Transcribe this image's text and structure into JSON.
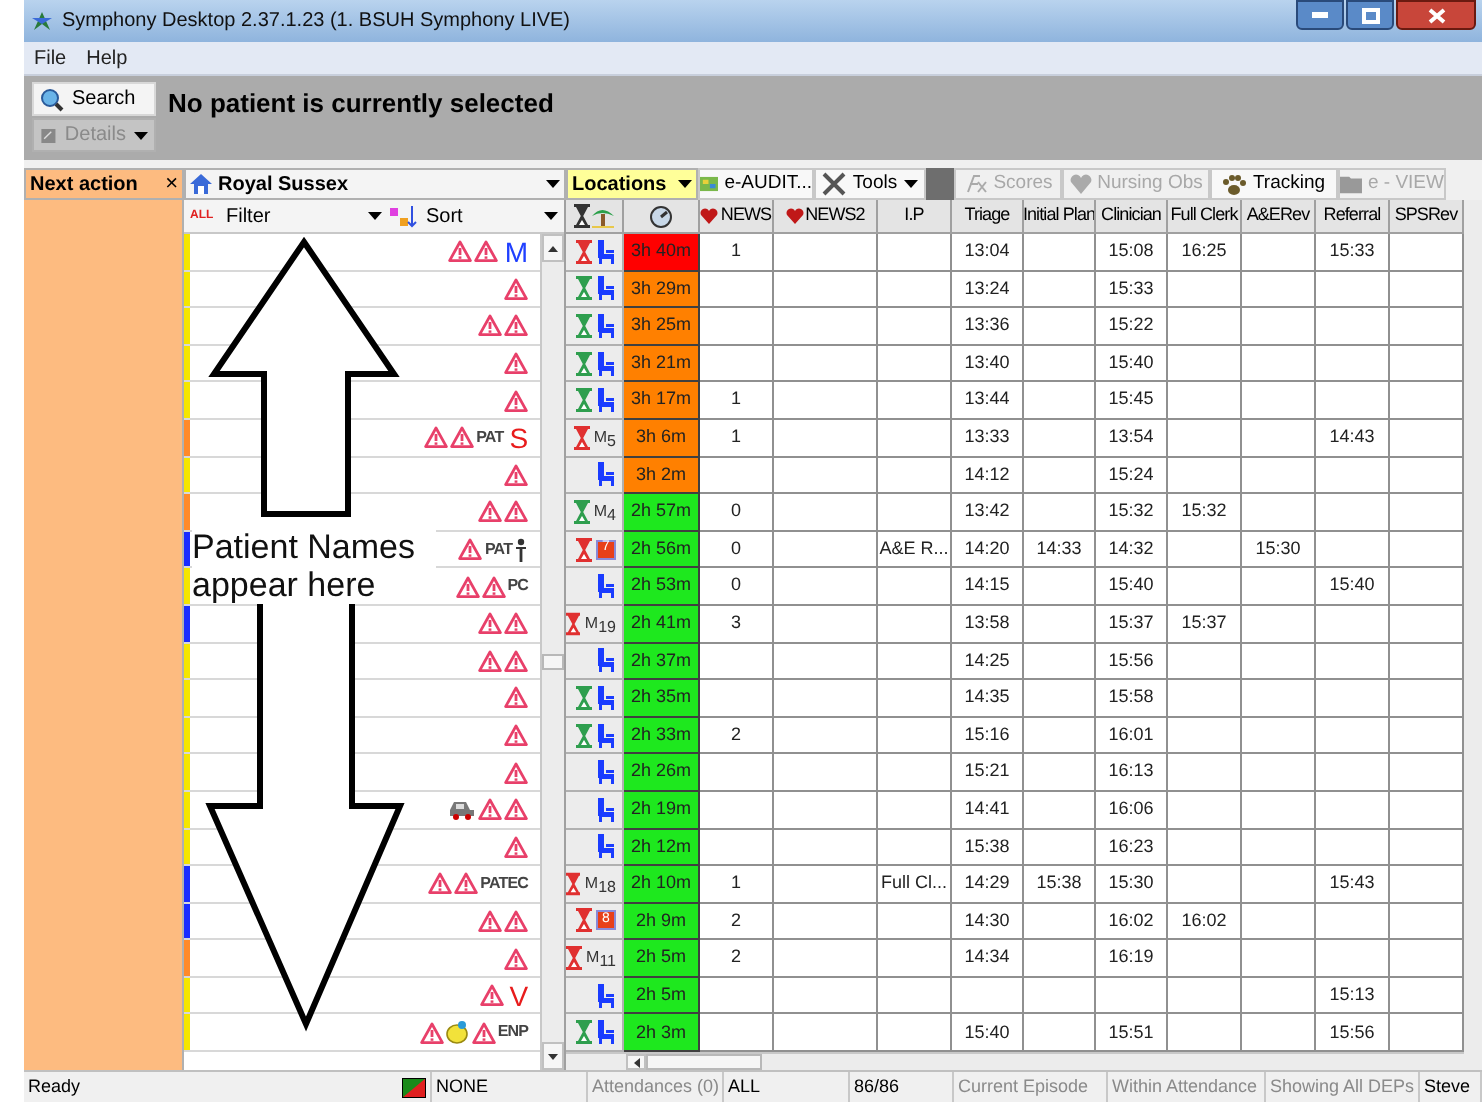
{
  "window": {
    "title": "Symphony Desktop 2.37.1.23 (1. BSUH Symphony LIVE)"
  },
  "menu": [
    {
      "label": "File"
    },
    {
      "label": "Help"
    }
  ],
  "patient_bar": {
    "buttons": [
      {
        "label": "Search",
        "disabled": false
      },
      {
        "label": "Details",
        "disabled": true
      }
    ],
    "message": "No patient is currently selected"
  },
  "next_action": {
    "label": "Next action",
    "close": "×"
  },
  "site": {
    "value": "Royal Sussex"
  },
  "locations": {
    "value": "Locations"
  },
  "toolbar": [
    {
      "label": "e-AUDIT...",
      "disabled": false,
      "kind": "button"
    },
    {
      "label": "Tools",
      "disabled": false,
      "kind": "menu"
    },
    {
      "label": "Scores",
      "disabled": true,
      "kind": "button"
    },
    {
      "label": "Nursing Obs",
      "disabled": true,
      "kind": "button"
    },
    {
      "label": "Tracking",
      "disabled": false,
      "kind": "button"
    },
    {
      "label": "e - VIEW",
      "disabled": true,
      "kind": "button"
    }
  ],
  "list_header": {
    "all": "ALL",
    "filter": "Filter",
    "sort": "Sort"
  },
  "columns": [
    "NEWS",
    "NEWS2",
    "I.P",
    "Triage",
    "Initial Plan",
    "Clinician",
    "Full Clerk",
    "A&ERev",
    "Referral",
    "SPSRev"
  ],
  "annotation": {
    "text": "Patient Names appear here"
  },
  "rows": [
    {
      "color": "#f5e600",
      "flags": [
        {
          "kind": "alert"
        },
        {
          "kind": "alert"
        },
        {
          "kind": "letter",
          "text": "M",
          "color": "#2040ff"
        }
      ],
      "timer": {
        "color": "#e03030"
      },
      "status": {
        "kind": "chair"
      },
      "wait": {
        "text": "3h 40m",
        "color": "#ff0000"
      },
      "cells": [
        "1",
        null,
        null,
        "13:04",
        null,
        "15:08",
        "16:25",
        null,
        "15:33",
        null
      ]
    },
    {
      "color": "#f5e600",
      "flags": [
        {
          "kind": "alert"
        }
      ],
      "timer": {
        "color": "#2e9e4e"
      },
      "status": {
        "kind": "chair"
      },
      "wait": {
        "text": "3h 29m",
        "color": "#ff8000"
      },
      "cells": [
        null,
        null,
        null,
        "13:24",
        null,
        "15:33",
        null,
        null,
        null,
        null
      ]
    },
    {
      "color": "#f5e600",
      "flags": [
        {
          "kind": "alert"
        },
        {
          "kind": "alert"
        }
      ],
      "timer": {
        "color": "#2e9e4e"
      },
      "status": {
        "kind": "chair"
      },
      "wait": {
        "text": "3h 25m",
        "color": "#ff8000"
      },
      "cells": [
        null,
        null,
        null,
        "13:36",
        null,
        "15:22",
        null,
        null,
        null,
        null
      ]
    },
    {
      "color": "#f5e600",
      "flags": [
        {
          "kind": "alert"
        }
      ],
      "timer": {
        "color": "#2e9e4e"
      },
      "status": {
        "kind": "chair"
      },
      "wait": {
        "text": "3h 21m",
        "color": "#ff8000"
      },
      "cells": [
        null,
        null,
        null,
        "13:40",
        null,
        "15:40",
        null,
        null,
        null,
        null
      ]
    },
    {
      "color": "#f5e600",
      "flags": [
        {
          "kind": "alert"
        }
      ],
      "timer": {
        "color": "#2e9e4e"
      },
      "status": {
        "kind": "chair"
      },
      "wait": {
        "text": "3h 17m",
        "color": "#ff8000"
      },
      "cells": [
        "1",
        null,
        null,
        "13:44",
        null,
        "15:45",
        null,
        null,
        null,
        null
      ]
    },
    {
      "color": "#ff8a2a",
      "flags": [
        {
          "kind": "alert"
        },
        {
          "kind": "alert"
        },
        {
          "kind": "code",
          "text": "PAT"
        },
        {
          "kind": "letter",
          "text": "S",
          "color": "#e81c1c"
        }
      ],
      "timer": {
        "color": "#e03030"
      },
      "status": {
        "kind": "m",
        "text": "M",
        "sub": "5"
      },
      "wait": {
        "text": "3h 6m",
        "color": "#ff8000"
      },
      "cells": [
        "1",
        null,
        null,
        "13:33",
        null,
        "13:54",
        null,
        null,
        "14:43",
        null
      ]
    },
    {
      "color": "#f5e600",
      "flags": [
        {
          "kind": "alert"
        }
      ],
      "status": {
        "kind": "chair"
      },
      "wait": {
        "text": "3h 2m",
        "color": "#ff8000"
      },
      "cells": [
        null,
        null,
        null,
        "14:12",
        null,
        "15:24",
        null,
        null,
        null,
        null
      ]
    },
    {
      "color": "#ff8a2a",
      "flags": [
        {
          "kind": "alert"
        },
        {
          "kind": "alert"
        }
      ],
      "timer": {
        "color": "#2e9e4e"
      },
      "status": {
        "kind": "m",
        "text": "M",
        "sub": "4"
      },
      "wait": {
        "text": "2h 57m",
        "color": "#1ee81e"
      },
      "cells": [
        "0",
        null,
        null,
        "13:42",
        null,
        "15:32",
        "15:32",
        null,
        null,
        null
      ]
    },
    {
      "color": "#1a2cff",
      "flags": [
        {
          "kind": "alert"
        },
        {
          "kind": "code",
          "text": "PAT"
        },
        {
          "kind": "person"
        }
      ],
      "timer": {
        "color": "#e03030"
      },
      "status": {
        "kind": "badge",
        "text": "7"
      },
      "wait": {
        "text": "2h 56m",
        "color": "#1ee81e"
      },
      "cells": [
        "0",
        null,
        "A&E R...",
        "14:20",
        "14:33",
        "14:32",
        null,
        "15:30",
        null,
        null
      ]
    },
    {
      "color": "#f5e600",
      "flags": [
        {
          "kind": "alert"
        },
        {
          "kind": "alert"
        },
        {
          "kind": "code",
          "text": "PC"
        }
      ],
      "status": {
        "kind": "chair"
      },
      "wait": {
        "text": "2h 53m",
        "color": "#1ee81e"
      },
      "cells": [
        "0",
        null,
        null,
        "14:15",
        null,
        "15:40",
        null,
        null,
        "15:40",
        null
      ]
    },
    {
      "color": "#1a2cff",
      "flags": [
        {
          "kind": "alert"
        },
        {
          "kind": "alert"
        }
      ],
      "timer": {
        "color": "#e03030"
      },
      "status": {
        "kind": "m",
        "text": "M",
        "sub": "19"
      },
      "wait": {
        "text": "2h 41m",
        "color": "#1ee81e"
      },
      "cells": [
        "3",
        null,
        null,
        "13:58",
        null,
        "15:37",
        "15:37",
        null,
        null,
        null
      ]
    },
    {
      "color": "#f5e600",
      "flags": [
        {
          "kind": "alert"
        },
        {
          "kind": "alert"
        }
      ],
      "status": {
        "kind": "chair"
      },
      "wait": {
        "text": "2h 37m",
        "color": "#1ee81e"
      },
      "cells": [
        null,
        null,
        null,
        "14:25",
        null,
        "15:56",
        null,
        null,
        null,
        null
      ]
    },
    {
      "color": "#f5e600",
      "flags": [
        {
          "kind": "alert"
        }
      ],
      "timer": {
        "color": "#2e9e4e"
      },
      "status": {
        "kind": "chair"
      },
      "wait": {
        "text": "2h 35m",
        "color": "#1ee81e"
      },
      "cells": [
        null,
        null,
        null,
        "14:35",
        null,
        "15:58",
        null,
        null,
        null,
        null
      ]
    },
    {
      "color": "#f5e600",
      "flags": [
        {
          "kind": "alert"
        }
      ],
      "timer": {
        "color": "#2e9e4e"
      },
      "status": {
        "kind": "chair"
      },
      "wait": {
        "text": "2h 33m",
        "color": "#1ee81e"
      },
      "cells": [
        "2",
        null,
        null,
        "15:16",
        null,
        "16:01",
        null,
        null,
        null,
        null
      ]
    },
    {
      "color": "#f5e600",
      "flags": [
        {
          "kind": "alert"
        }
      ],
      "status": {
        "kind": "chair"
      },
      "wait": {
        "text": "2h 26m",
        "color": "#1ee81e"
      },
      "cells": [
        null,
        null,
        null,
        "15:21",
        null,
        "16:13",
        null,
        null,
        null,
        null
      ]
    },
    {
      "color": "#f5e600",
      "flags": [
        {
          "kind": "vehicle"
        },
        {
          "kind": "alert"
        },
        {
          "kind": "alert"
        }
      ],
      "status": {
        "kind": "chair"
      },
      "wait": {
        "text": "2h 19m",
        "color": "#1ee81e"
      },
      "cells": [
        null,
        null,
        null,
        "14:41",
        null,
        "16:06",
        null,
        null,
        null,
        null
      ]
    },
    {
      "color": "#f5e600",
      "flags": [
        {
          "kind": "alert"
        }
      ],
      "status": {
        "kind": "chair"
      },
      "wait": {
        "text": "2h 12m",
        "color": "#1ee81e"
      },
      "cells": [
        null,
        null,
        null,
        "15:38",
        null,
        "16:23",
        null,
        null,
        null,
        null
      ]
    },
    {
      "color": "#1a2cff",
      "flags": [
        {
          "kind": "alert"
        },
        {
          "kind": "alert"
        },
        {
          "kind": "code",
          "text": "PATEC"
        }
      ],
      "timer": {
        "color": "#e03030"
      },
      "status": {
        "kind": "m",
        "text": "M",
        "sub": "18"
      },
      "wait": {
        "text": "2h 10m",
        "color": "#1ee81e"
      },
      "cells": [
        "1",
        null,
        "Full Cl...",
        "14:29",
        "15:38",
        "15:30",
        null,
        null,
        "15:43",
        null
      ]
    },
    {
      "color": "#1a2cff",
      "flags": [
        {
          "kind": "alert"
        },
        {
          "kind": "alert"
        }
      ],
      "timer": {
        "color": "#e03030"
      },
      "status": {
        "kind": "badge",
        "text": "8"
      },
      "wait": {
        "text": "2h 9m",
        "color": "#1ee81e"
      },
      "cells": [
        "2",
        null,
        null,
        "14:30",
        null,
        "16:02",
        "16:02",
        null,
        null,
        null
      ]
    },
    {
      "color": "#ff8a2a",
      "flags": [
        {
          "kind": "alert"
        }
      ],
      "timer": {
        "color": "#e03030"
      },
      "status": {
        "kind": "m",
        "text": "M",
        "sub": "11"
      },
      "wait": {
        "text": "2h 5m",
        "color": "#1ee81e"
      },
      "cells": [
        "2",
        null,
        null,
        "14:34",
        null,
        "16:19",
        null,
        null,
        null,
        null
      ]
    },
    {
      "color": "#f5e600",
      "flags": [
        {
          "kind": "alert"
        },
        {
          "kind": "letter",
          "text": "V",
          "color": "#e81c1c"
        }
      ],
      "status": {
        "kind": "chair"
      },
      "wait": {
        "text": "2h 5m",
        "color": "#1ee81e"
      },
      "cells": [
        null,
        null,
        null,
        null,
        null,
        null,
        null,
        null,
        "15:13",
        null
      ]
    },
    {
      "color": "#f5e600",
      "flags": [
        {
          "kind": "alert"
        },
        {
          "kind": "fruit"
        },
        {
          "kind": "alert"
        },
        {
          "kind": "code",
          "text": "ENP"
        }
      ],
      "timer": {
        "color": "#2e9e4e"
      },
      "status": {
        "kind": "chair"
      },
      "wait": {
        "text": "2h 3m",
        "color": "#1ee81e"
      },
      "cells": [
        null,
        null,
        null,
        "15:40",
        null,
        "15:51",
        null,
        null,
        "15:56",
        null
      ]
    }
  ],
  "status_bar": [
    {
      "text": "Ready",
      "disabled": false
    },
    {
      "text": "NONE",
      "disabled": false
    },
    {
      "text": "Attendances (0)",
      "disabled": true
    },
    {
      "text": "ALL",
      "disabled": false
    },
    {
      "text": "86/86",
      "disabled": false
    },
    {
      "text": "Current Episode",
      "disabled": true
    },
    {
      "text": "Within Attendance",
      "disabled": true
    },
    {
      "text": "Showing All DEPs",
      "disabled": true
    },
    {
      "text": "Steve",
      "disabled": false
    }
  ]
}
